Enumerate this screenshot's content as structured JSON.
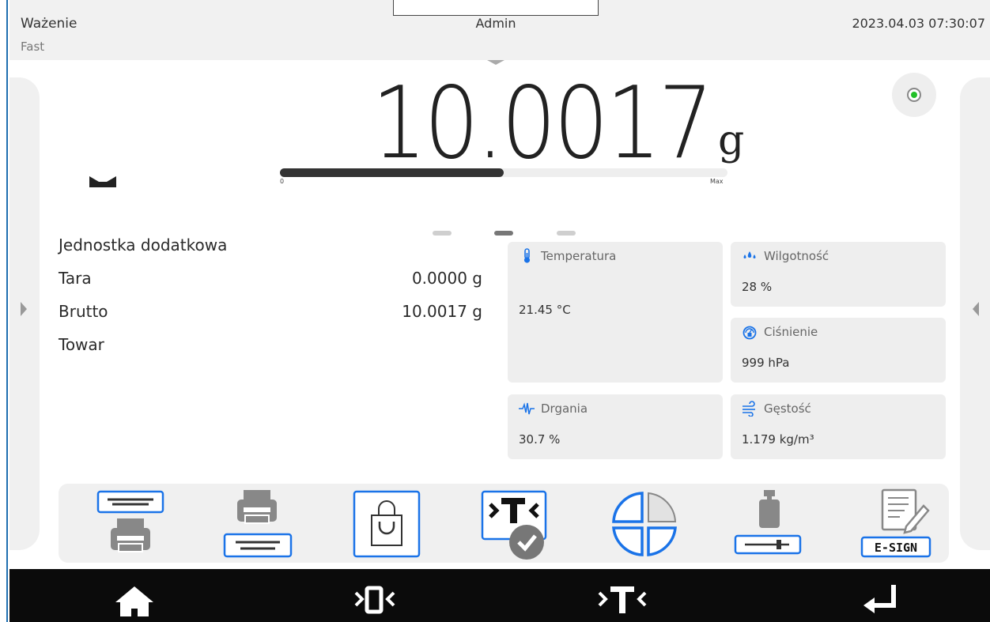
{
  "header": {
    "title": "Ważenie",
    "mode": "Fast",
    "user": "Admin",
    "datetime": "2023.04.03 07:30:07"
  },
  "reading": {
    "value": "10.0017",
    "unit": "g",
    "bar_min": "0",
    "bar_max": "Max",
    "bar_fill_fraction": 0.5,
    "status_led_color": "#22c028"
  },
  "pager": {
    "count": 3,
    "active_index": 1
  },
  "info": [
    {
      "label": "Jednostka dodatkowa",
      "value": ""
    },
    {
      "label": "Tara",
      "value": "0.0000 g"
    },
    {
      "label": "Brutto",
      "value": "10.0017 g"
    },
    {
      "label": "Towar",
      "value": ""
    }
  ],
  "tiles": {
    "temperature": {
      "icon": "thermometer-icon",
      "label": "Temperatura",
      "value": "21.45 °C"
    },
    "humidity": {
      "icon": "drops-icon",
      "label": "Wilgotność",
      "value": "28 %"
    },
    "pressure": {
      "icon": "gauge-icon",
      "label": "Ciśnienie",
      "value": "999 hPa"
    },
    "vibration": {
      "icon": "vibration-icon",
      "label": "Drgania",
      "value": "30.7 %"
    },
    "density": {
      "icon": "wind-icon",
      "label": "Gęstość",
      "value": "1.179 kg/m³"
    }
  },
  "toolbar": {
    "esign_label": "E-SIGN",
    "buttons": [
      "header-print-icon",
      "footer-print-icon",
      "product-icon",
      "tare-confirm-icon",
      "segments-icon",
      "weight-calibration-icon",
      "esign-icon"
    ]
  },
  "navbar": {
    "buttons": [
      "home-icon",
      "zero-icon",
      "tare-icon",
      "enter-icon"
    ]
  },
  "colors": {
    "accent": "#1f6fb0",
    "icon_blue": "#1a73e8",
    "tile_bg": "#eeeeee",
    "navbar_bg": "#0b0b0b"
  }
}
